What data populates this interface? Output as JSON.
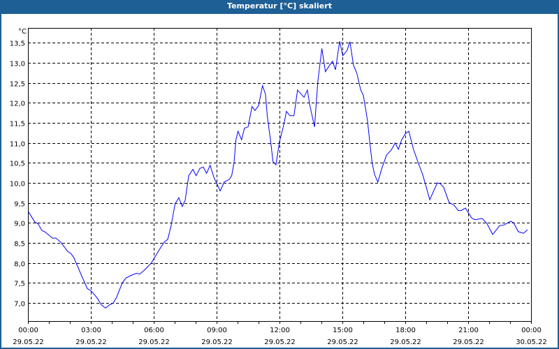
{
  "window": {
    "title": "Temperatur [°C] skaliert"
  },
  "colors": {
    "titlebar": "#1e5f96",
    "line": "#0000ff",
    "grid": "#000000"
  },
  "chart_data": {
    "type": "line",
    "title": "Temperatur [°C] skaliert",
    "ylabel": "°C",
    "xlabel": "",
    "xlim": [
      0,
      24
    ],
    "ylim": [
      6.545,
      13.875
    ],
    "grid": true,
    "yticks": [
      7.0,
      7.5,
      8.0,
      8.5,
      9.0,
      9.5,
      10.0,
      10.5,
      11.0,
      11.5,
      12.0,
      12.5,
      13.0,
      13.5
    ],
    "ytick_labels": [
      "7,0",
      "7,5",
      "8,0",
      "8,5",
      "9,0",
      "9,5",
      "10,0",
      "10,5",
      "11,0",
      "11,5",
      "12,0",
      "12,5",
      "13,0",
      "13,5"
    ],
    "xticks": [
      0,
      3,
      6,
      9,
      12,
      15,
      18,
      21,
      24
    ],
    "xtick_labels": [
      {
        "time": "00:00",
        "date": "29.05.22"
      },
      {
        "time": "03:00",
        "date": "29.05.22"
      },
      {
        "time": "06:00",
        "date": "29.05.22"
      },
      {
        "time": "09:00",
        "date": "29.05.22"
      },
      {
        "time": "12:00",
        "date": "29.05.22"
      },
      {
        "time": "15:00",
        "date": "29.05.22"
      },
      {
        "time": "18:00",
        "date": "29.05.22"
      },
      {
        "time": "21:00",
        "date": "29.05.22"
      },
      {
        "time": "00:00",
        "date": "30.05.22"
      }
    ],
    "series": [
      {
        "name": "Temperatur",
        "x": [
          0.02,
          0.33,
          0.48,
          0.67,
          0.83,
          1.17,
          1.33,
          1.56,
          1.89,
          2.06,
          2.2,
          2.56,
          2.83,
          3.03,
          3.17,
          3.33,
          3.5,
          3.7,
          3.89,
          4.06,
          4.22,
          4.5,
          4.67,
          4.89,
          5.17,
          5.33,
          5.56,
          5.89,
          6.22,
          6.5,
          6.67,
          6.83,
          7.02,
          7.2,
          7.36,
          7.5,
          7.67,
          7.87,
          8.02,
          8.2,
          8.36,
          8.52,
          8.69,
          8.87,
          9.17,
          9.36,
          9.61,
          9.72,
          9.83,
          9.92,
          10.02,
          10.19,
          10.33,
          10.5,
          10.69,
          10.83,
          11.0,
          11.19,
          11.33,
          11.42,
          11.58,
          11.69,
          11.83,
          12.0,
          12.22,
          12.33,
          12.5,
          12.69,
          12.86,
          13.17,
          13.33,
          13.44,
          13.67,
          13.83,
          14.02,
          14.19,
          14.36,
          14.53,
          14.67,
          14.87,
          15.02,
          15.22,
          15.36,
          15.53,
          15.69,
          15.87,
          16.0,
          16.2,
          16.31,
          16.42,
          16.53,
          16.69,
          16.89,
          17.11,
          17.33,
          17.52,
          17.67,
          17.83,
          18.0,
          18.17,
          18.39,
          18.64,
          18.83,
          19.17,
          19.33,
          19.53,
          19.67,
          19.83,
          20.09,
          20.33,
          20.53,
          20.67,
          20.87,
          21.17,
          21.33,
          21.67,
          21.89,
          22.17,
          22.5,
          22.72,
          23.02,
          23.17,
          23.39,
          23.64,
          23.83
        ],
        "y": [
          9.28,
          9.02,
          8.98,
          8.81,
          8.77,
          8.62,
          8.62,
          8.52,
          8.29,
          8.23,
          8.12,
          7.68,
          7.36,
          7.29,
          7.21,
          7.1,
          6.95,
          6.87,
          6.95,
          6.99,
          7.13,
          7.5,
          7.62,
          7.68,
          7.74,
          7.72,
          7.82,
          8.0,
          8.29,
          8.52,
          8.59,
          8.93,
          9.48,
          9.63,
          9.41,
          9.57,
          10.18,
          10.34,
          10.18,
          10.36,
          10.4,
          10.24,
          10.44,
          10.14,
          9.8,
          10.02,
          10.09,
          10.18,
          10.5,
          11.08,
          11.29,
          11.08,
          11.37,
          11.4,
          11.91,
          11.81,
          11.93,
          12.43,
          12.22,
          11.66,
          11.03,
          10.53,
          10.45,
          11.03,
          11.49,
          11.79,
          11.68,
          11.68,
          12.32,
          12.14,
          12.32,
          11.96,
          11.4,
          12.54,
          13.36,
          12.78,
          12.92,
          13.04,
          12.83,
          13.54,
          13.18,
          13.31,
          13.53,
          12.94,
          12.74,
          12.33,
          12.19,
          11.55,
          11.0,
          10.5,
          10.22,
          10.02,
          10.38,
          10.7,
          10.82,
          11.0,
          10.84,
          11.08,
          11.23,
          11.29,
          10.84,
          10.47,
          10.21,
          9.58,
          9.77,
          10.0,
          9.98,
          9.89,
          9.51,
          9.44,
          9.31,
          9.31,
          9.37,
          9.12,
          9.08,
          9.11,
          8.99,
          8.71,
          8.93,
          8.95,
          9.04,
          9.0,
          8.78,
          8.74,
          8.83
        ]
      }
    ]
  }
}
